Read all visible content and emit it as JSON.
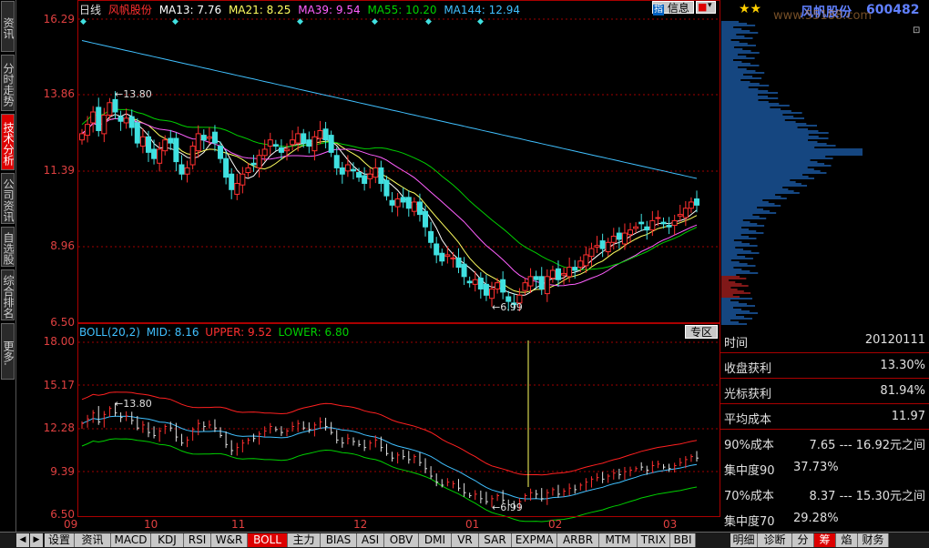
{
  "colors": {
    "grid": "#a00000",
    "up_candle": "#ff3030",
    "down_candle": "#40e0e0",
    "ma13": "#ffffff",
    "ma21": "#ffff60",
    "ma39": "#ff60ff",
    "ma55": "#00d000",
    "ma144": "#40c0ff",
    "boll_mid": "#40c0ff",
    "boll_upper": "#ff2020",
    "boll_lower": "#00d000",
    "cursor": "#ffff60"
  },
  "left_tabs": [
    {
      "label": "资讯",
      "active": false
    },
    {
      "label": "分时走势",
      "active": false
    },
    {
      "label": "技术分析",
      "active": true
    },
    {
      "label": "公司资讯",
      "active": false
    },
    {
      "label": "自选股",
      "active": false
    },
    {
      "label": "综合排名",
      "active": false
    },
    {
      "label": "更多.",
      "active": false
    }
  ],
  "main_header": {
    "period": "日线",
    "stock": "风帆股份",
    "ma13": "MA13: 7.76",
    "ma21": "MA21: 8.25",
    "ma39": "MA39: 9.54",
    "ma55": "MA55: 10.20",
    "ma144": "MA144: 12.94"
  },
  "top_buttons": {
    "info": "信息"
  },
  "price_axis": [
    "16.29",
    "13.86",
    "11.39",
    "8.96",
    "6.50"
  ],
  "annotations": {
    "high": "13.80",
    "low": "6.99"
  },
  "boll_header": {
    "name": "BOLL(20,2)",
    "mid": "MID: 8.16",
    "upper": "UPPER: 9.52",
    "lower": "LOWER: 6.80"
  },
  "zone_button": "专区",
  "boll_axis": [
    "18.00",
    "15.17",
    "12.28",
    "9.39",
    "6.50"
  ],
  "x_axis": [
    "09",
    "10",
    "11",
    "12",
    "01",
    "02",
    "03"
  ],
  "right_header": {
    "stars": "★★",
    "stock": "风帆股份",
    "code": "600482",
    "watermark": "www.55188.com"
  },
  "info_panel": [
    {
      "key": "时间",
      "value": "20120111"
    },
    {
      "key": "收盘获利",
      "value": "13.30%"
    },
    {
      "key": "光标获利",
      "value": "81.94%"
    },
    {
      "key": "平均成本",
      "value": "11.97"
    }
  ],
  "cost_panel": [
    {
      "key": "90%成本",
      "value": "7.65 ---     16.92元之间"
    },
    {
      "key": "集中度90",
      "value": "37.73%"
    },
    {
      "key": "70%成本",
      "value": "8.37 ---     15.30元之间"
    },
    {
      "key": "集中度70",
      "value": "29.28%"
    }
  ],
  "bottom_tabs": [
    "设置",
    "资讯",
    "MACD",
    "KDJ",
    "RSI",
    "W&R",
    "BOLL",
    "主力",
    "BIAS",
    "ASI",
    "OBV",
    "DMI",
    "VR",
    "SAR",
    "EXPMA",
    "ARBR",
    "MTM",
    "TRIX",
    "BBI"
  ],
  "bottom_tabs_active": "BOLL",
  "right_bottom_tabs": [
    "明细",
    "诊断",
    "分",
    "筹",
    "焰",
    "财务"
  ],
  "right_bottom_active": "筹",
  "chart_data": {
    "type": "candlestick",
    "title": "风帆股份",
    "period": "日线",
    "x_ticks": [
      "09",
      "10",
      "11",
      "12",
      "01",
      "02",
      "03"
    ],
    "y_range": [
      6.5,
      16.29
    ],
    "series": [
      {
        "name": "MA13",
        "value": 7.76
      },
      {
        "name": "MA21",
        "value": 8.25
      },
      {
        "name": "MA39",
        "value": 9.54
      },
      {
        "name": "MA55",
        "value": 10.2
      },
      {
        "name": "MA144",
        "value": 12.94
      }
    ],
    "close": [
      12.6,
      12.9,
      13.3,
      12.7,
      13.2,
      13.6,
      13.3,
      13.0,
      13.1,
      12.8,
      12.3,
      12.5,
      12.0,
      11.8,
      12.1,
      12.4,
      12.3,
      11.7,
      11.3,
      11.5,
      12.2,
      12.6,
      12.4,
      12.5,
      12.3,
      11.8,
      11.2,
      10.8,
      11.0,
      11.3,
      11.5,
      11.6,
      11.9,
      12.1,
      12.4,
      12.2,
      12.0,
      12.1,
      12.4,
      12.6,
      12.3,
      12.2,
      12.5,
      12.7,
      12.4,
      12.0,
      11.5,
      11.3,
      11.6,
      11.4,
      11.2,
      11.0,
      11.3,
      11.5,
      11.0,
      10.6,
      10.3,
      10.5,
      10.4,
      10.2,
      10.4,
      10.0,
      9.6,
      9.1,
      8.7,
      8.5,
      8.7,
      8.6,
      8.3,
      8.0,
      7.8,
      7.9,
      7.6,
      7.4,
      7.6,
      7.8,
      7.5,
      7.2,
      7.1,
      7.4,
      7.8,
      8.0,
      7.9,
      7.6,
      8.0,
      8.2,
      7.9,
      8.1,
      8.3,
      8.2,
      8.5,
      8.7,
      8.9,
      9.0,
      8.9,
      9.1,
      9.3,
      9.2,
      9.4,
      9.5,
      9.6,
      9.7,
      9.5,
      9.8,
      9.9,
      9.7,
      9.6,
      9.8,
      10.0,
      10.2,
      10.4,
      10.3
    ]
  }
}
